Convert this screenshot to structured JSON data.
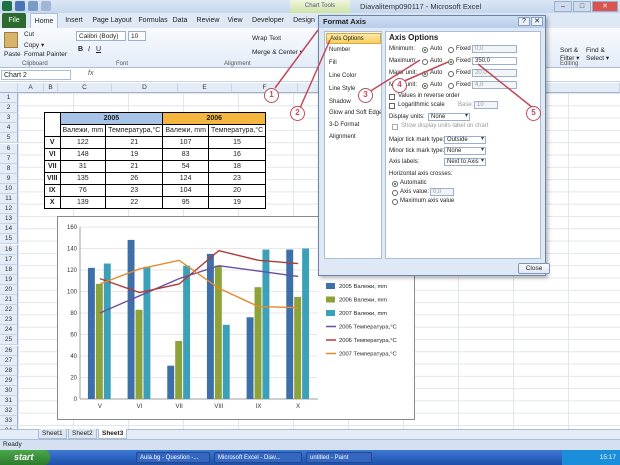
{
  "window": {
    "title": "Diavalitemp090117 - Microsoft Excel",
    "chart_tools_label": "Chart Tools"
  },
  "tabs": [
    "File",
    "Home",
    "Insert",
    "Page Layout",
    "Formulas",
    "Data",
    "Review",
    "View",
    "Developer",
    "Design"
  ],
  "ribbon": {
    "paste": "Paste",
    "cut": "Cut",
    "copy": "Copy ▾",
    "format_painter": "Format Painter",
    "font_name": "Calibri (Body)",
    "font_size": "10",
    "wrap_text": "Wrap Text",
    "merge_center": "Merge & Center ▾",
    "sort_filter": "Sort & Filter ▾",
    "find_select": "Find & Select ▾",
    "groups": {
      "clipboard": "Clipboard",
      "font": "Font",
      "alignment": "Alignment",
      "editing": "Editing"
    }
  },
  "formula_bar": {
    "name_box": "Chart 2",
    "fx": "fx"
  },
  "columns": [
    "A",
    "B",
    "C",
    "D",
    "E",
    "F",
    "G"
  ],
  "rows": [
    "1",
    "2",
    "3",
    "4",
    "5",
    "6",
    "7",
    "8",
    "9",
    "10",
    "11",
    "12",
    "13",
    "14",
    "15",
    "16",
    "17",
    "18",
    "19",
    "20",
    "21",
    "22",
    "23",
    "24",
    "25",
    "26",
    "27",
    "28",
    "29",
    "30",
    "31",
    "32",
    "33",
    "34"
  ],
  "table": {
    "years": [
      "2005",
      "2006"
    ],
    "headers": [
      "Валежи, mm",
      "Температура,°C",
      "Валежи, mm",
      "Температура,°C"
    ],
    "rows": [
      {
        "label": "V",
        "c": [
          "122",
          "21",
          "107",
          "15"
        ]
      },
      {
        "label": "VI",
        "c": [
          "148",
          "19",
          "83",
          "16"
        ]
      },
      {
        "label": "VII",
        "c": [
          "31",
          "21",
          "54",
          "18"
        ]
      },
      {
        "label": "VIII",
        "c": [
          "135",
          "26",
          "124",
          "23"
        ]
      },
      {
        "label": "IX",
        "c": [
          "76",
          "23",
          "104",
          "20"
        ]
      },
      {
        "label": "X",
        "c": [
          "139",
          "22",
          "95",
          "19"
        ]
      }
    ]
  },
  "chart_data": {
    "type": "bar",
    "categories": [
      "V",
      "VI",
      "VII",
      "VIII",
      "IX",
      "X"
    ],
    "ylim": [
      0,
      160
    ],
    "yticks": [
      "0",
      "20",
      "40",
      "60",
      "80",
      "100",
      "120",
      "140",
      "160"
    ],
    "series": [
      {
        "name": "2005 Валежи, mm",
        "kind": "bar",
        "color": "#3d6fa8",
        "values": [
          122,
          148,
          31,
          135,
          76,
          139
        ]
      },
      {
        "name": "2006 Валежи, mm",
        "kind": "bar",
        "color": "#8ea23a",
        "values": [
          107,
          83,
          54,
          124,
          104,
          95
        ]
      },
      {
        "name": "2007 Валежи, mm",
        "kind": "bar",
        "color": "#3ba0b8",
        "values": [
          126,
          123,
          124,
          69,
          139,
          140
        ]
      },
      {
        "name": "2005 Температура,°C",
        "kind": "line",
        "color": "#6a4fa0",
        "values": [
          80,
          96,
          112,
          124,
          119,
          114
        ]
      },
      {
        "name": "2006 Температура,°C",
        "kind": "line",
        "color": "#b03a3a",
        "values": [
          112,
          99,
          107,
          138,
          129,
          126
        ]
      },
      {
        "name": "2007 Температура,°C",
        "kind": "line",
        "color": "#e38a2e",
        "values": [
          107,
          121,
          129,
          103,
          86,
          85
        ]
      }
    ]
  },
  "sheets": [
    "Sheet1",
    "Sheet2",
    "Sheet3"
  ],
  "status": {
    "ready": "Ready"
  },
  "taskbar": {
    "start": "start",
    "items": [
      "Aula.bg - Question -...",
      "Microsoft Excel - Diav...",
      "untitled - Paint"
    ],
    "clock": "15:17"
  },
  "dialog": {
    "title": "Format Axis",
    "nav": [
      "Axis Options",
      "Number",
      "Fill",
      "Line Color",
      "Line Style",
      "Shadow",
      "Glow and Soft Edges",
      "3-D Format",
      "Alignment"
    ],
    "heading": "Axis Options",
    "minimum": {
      "label": "Minimum:",
      "auto": "Auto",
      "fixed": "Fixed",
      "value": "0,0"
    },
    "maximum": {
      "label": "Maximum:",
      "auto": "Auto",
      "fixed": "Fixed",
      "value": "350,0"
    },
    "major": {
      "label": "Major unit:",
      "auto": "Auto",
      "fixed": "Fixed",
      "value": "20,0"
    },
    "minor": {
      "label": "Minor unit:",
      "auto": "Auto",
      "fixed": "Fixed",
      "value": "4,0"
    },
    "reverse": "Values in reverse order",
    "log": "Logarithmic scale",
    "log_base_label": "Base:",
    "log_base": "10",
    "display_units_label": "Display units:",
    "display_units": "None",
    "show_units": "Show display units label on chart",
    "major_tick_label": "Major tick mark type:",
    "major_tick": "Outside",
    "minor_tick_label": "Minor tick mark type:",
    "minor_tick": "None",
    "axis_labels_label": "Axis labels:",
    "axis_labels": "Next to Axis",
    "cross_label": "Horizontal axis crosses:",
    "cross_auto": "Automatic",
    "cross_value": "Axis value:",
    "cross_value_val": "0,0",
    "cross_max": "Maximum axis value",
    "close": "Close"
  },
  "markers": [
    "1",
    "2",
    "3",
    "4",
    "5"
  ]
}
